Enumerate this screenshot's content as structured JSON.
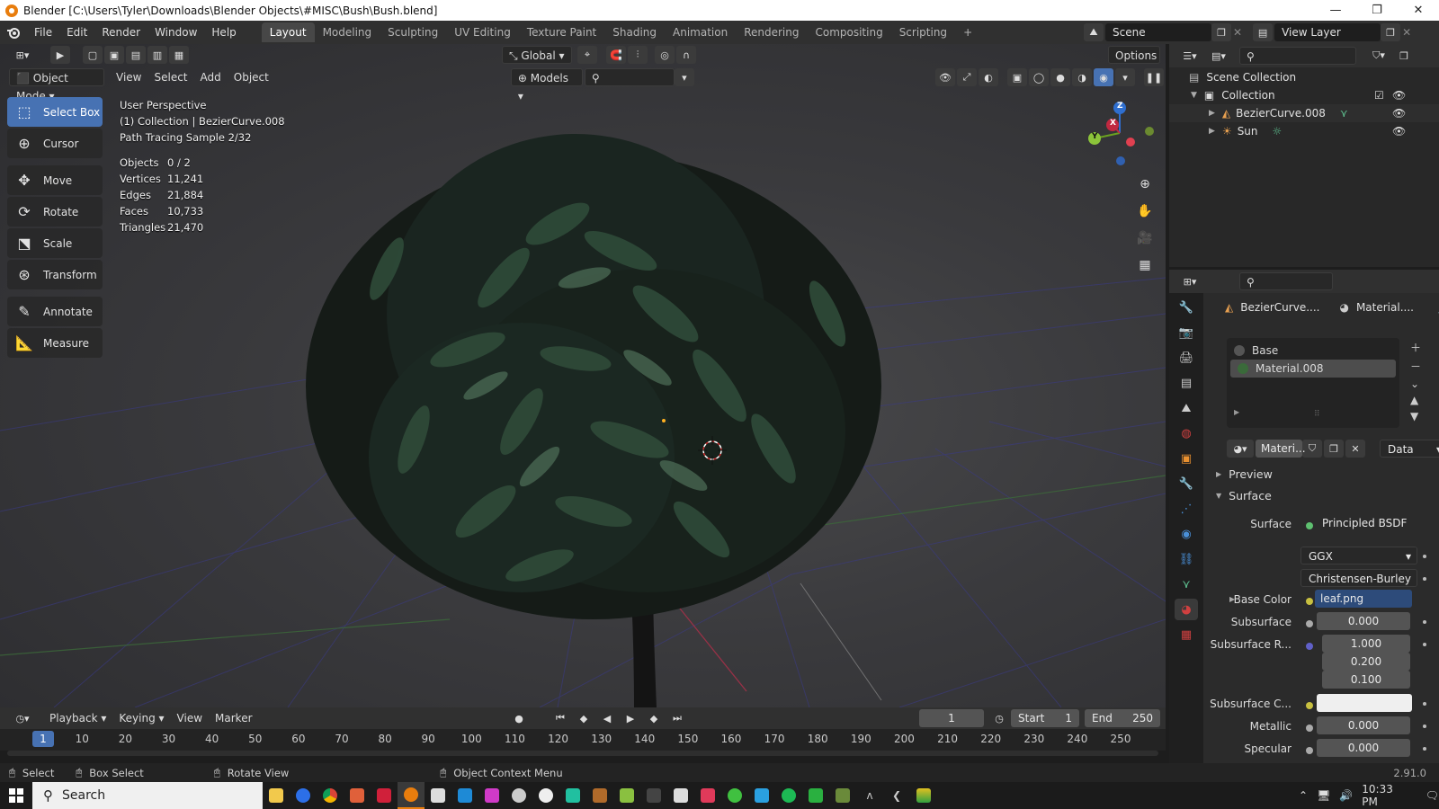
{
  "titlebar": {
    "title": "Blender [C:\\Users\\Tyler\\Downloads\\Blender Objects\\#MISC\\Bush\\Bush.blend]",
    "minimize": "—",
    "restore": "❐",
    "close": "✕"
  },
  "menu": [
    "File",
    "Edit",
    "Render",
    "Window",
    "Help"
  ],
  "workspaces": [
    "Layout",
    "Modeling",
    "Sculpting",
    "UV Editing",
    "Texture Paint",
    "Shading",
    "Animation",
    "Rendering",
    "Compositing",
    "Scripting"
  ],
  "scene": {
    "name": "Scene",
    "view_layer": "View Layer"
  },
  "viewport_header": {
    "orientation": "Global",
    "options": "Options",
    "mode": "Object Mode",
    "view": "View",
    "select": "Select",
    "add": "Add",
    "object": "Object",
    "collection_filter": "Models"
  },
  "tools": [
    "Select Box",
    "Cursor",
    "Move",
    "Rotate",
    "Scale",
    "Transform",
    "Annotate",
    "Measure"
  ],
  "overlay": {
    "perspective": "User Perspective",
    "collection": "(1) Collection | BezierCurve.008",
    "sample": "Path Tracing Sample 2/32",
    "stats": [
      {
        "k": "Objects",
        "v": "0 / 2"
      },
      {
        "k": "Vertices",
        "v": "11,241"
      },
      {
        "k": "Edges",
        "v": "21,884"
      },
      {
        "k": "Faces",
        "v": "10,733"
      },
      {
        "k": "Triangles",
        "v": "21,470"
      }
    ]
  },
  "gizmo": {
    "x": "X",
    "y": "Y",
    "z": "Z"
  },
  "outliner": {
    "scene_collection": "Scene Collection",
    "collection": "Collection",
    "objects": [
      "BezierCurve.008",
      "Sun"
    ]
  },
  "properties": {
    "object_name": "BezierCurve....",
    "material_name": "Material....",
    "slots": [
      "Base",
      "Material.008"
    ],
    "mat_field": "Materi...",
    "link": "Data",
    "preview": "Preview",
    "surface_panel": "Surface",
    "surface_label": "Surface",
    "surface_value": "Principled BSDF",
    "distribution": "GGX",
    "subsurface_method": "Christensen-Burley",
    "base_color_label": "Base Color",
    "base_color_value": "leaf.png",
    "subsurface_label": "Subsurface",
    "subsurface_value": "0.000",
    "subsurface_r_label": "Subsurface R...",
    "subsurface_r": [
      "1.000",
      "0.200",
      "0.100"
    ],
    "subsurface_c_label": "Subsurface C...",
    "metallic_label": "Metallic",
    "metallic_value": "0.000",
    "specular_label": "Specular",
    "specular_value": "0.000"
  },
  "timeline": {
    "playback": "Playback",
    "keying": "Keying",
    "view": "View",
    "marker": "Marker",
    "current_frame": "1",
    "start_label": "Start",
    "start": "1",
    "end_label": "End",
    "end": "250",
    "ticks": [
      "1",
      "10",
      "20",
      "30",
      "40",
      "50",
      "60",
      "70",
      "80",
      "90",
      "100",
      "110",
      "120",
      "130",
      "140",
      "150",
      "160",
      "170",
      "180",
      "190",
      "200",
      "210",
      "220",
      "230",
      "240",
      "250"
    ]
  },
  "statusbar": {
    "select": "Select",
    "box_select": "Box Select",
    "rotate_view": "Rotate View",
    "context_menu": "Object Context Menu",
    "version": "2.91.0"
  },
  "taskbar": {
    "search": "Search",
    "time": "10:33 PM"
  },
  "colors": {
    "accent": "#4772b3",
    "blender_orange": "#e87d0d",
    "leaf_dark": "#1f3326",
    "leaf_light": "#3d5c45"
  }
}
